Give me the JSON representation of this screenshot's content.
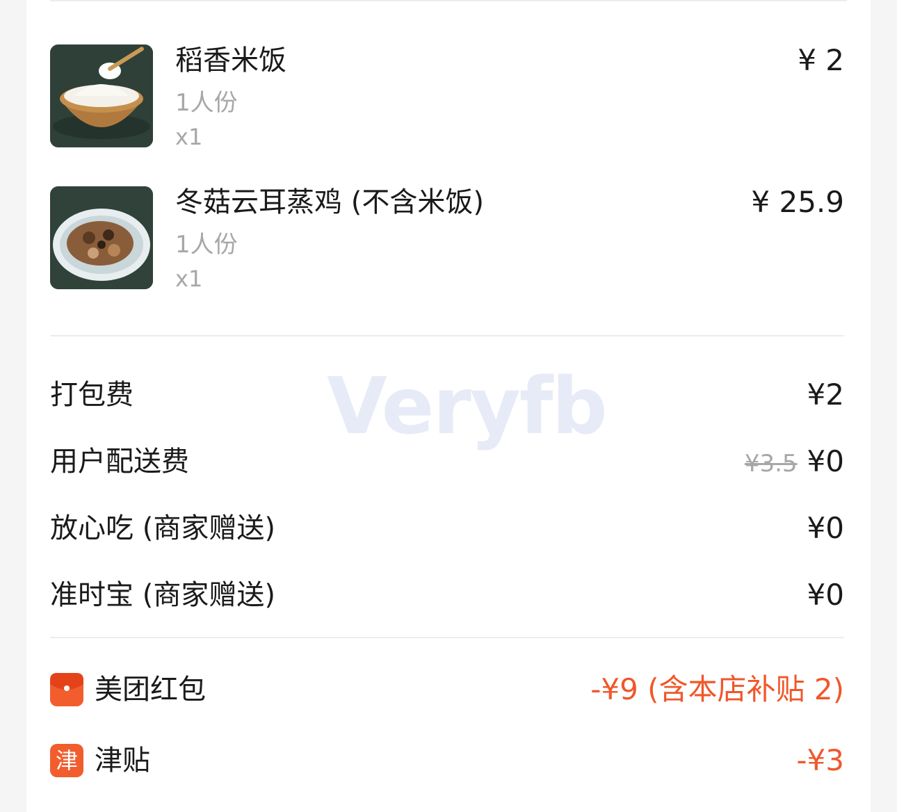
{
  "items": [
    {
      "name": "稻香米饭",
      "spec": "1人份",
      "qty": "x1",
      "price": "¥ 2",
      "image_icon": "rice-bowl-photo"
    },
    {
      "name": "冬菇云耳蒸鸡 (不含米饭)",
      "spec": "1人份",
      "qty": "x1",
      "price": "¥ 25.9",
      "image_icon": "steamed-chicken-photo"
    }
  ],
  "fees": [
    {
      "label": "打包费",
      "value": "¥2"
    },
    {
      "label": "用户配送费",
      "original": "¥3.5",
      "value": "¥0"
    },
    {
      "label": "放心吃 (商家赠送)",
      "value": "¥0"
    },
    {
      "label": "准时宝 (商家赠送)",
      "value": "¥0"
    }
  ],
  "promos": [
    {
      "label": "美团红包",
      "value": "-¥9 (含本店补贴 2)",
      "icon": "red-envelope-icon"
    },
    {
      "label": "津贴",
      "value": "-¥3",
      "icon_text": "津"
    }
  ],
  "watermark": "Veryfb",
  "colors": {
    "accent": "#f0572a",
    "muted": "#a7a7a7",
    "text": "#1a1a1a"
  }
}
